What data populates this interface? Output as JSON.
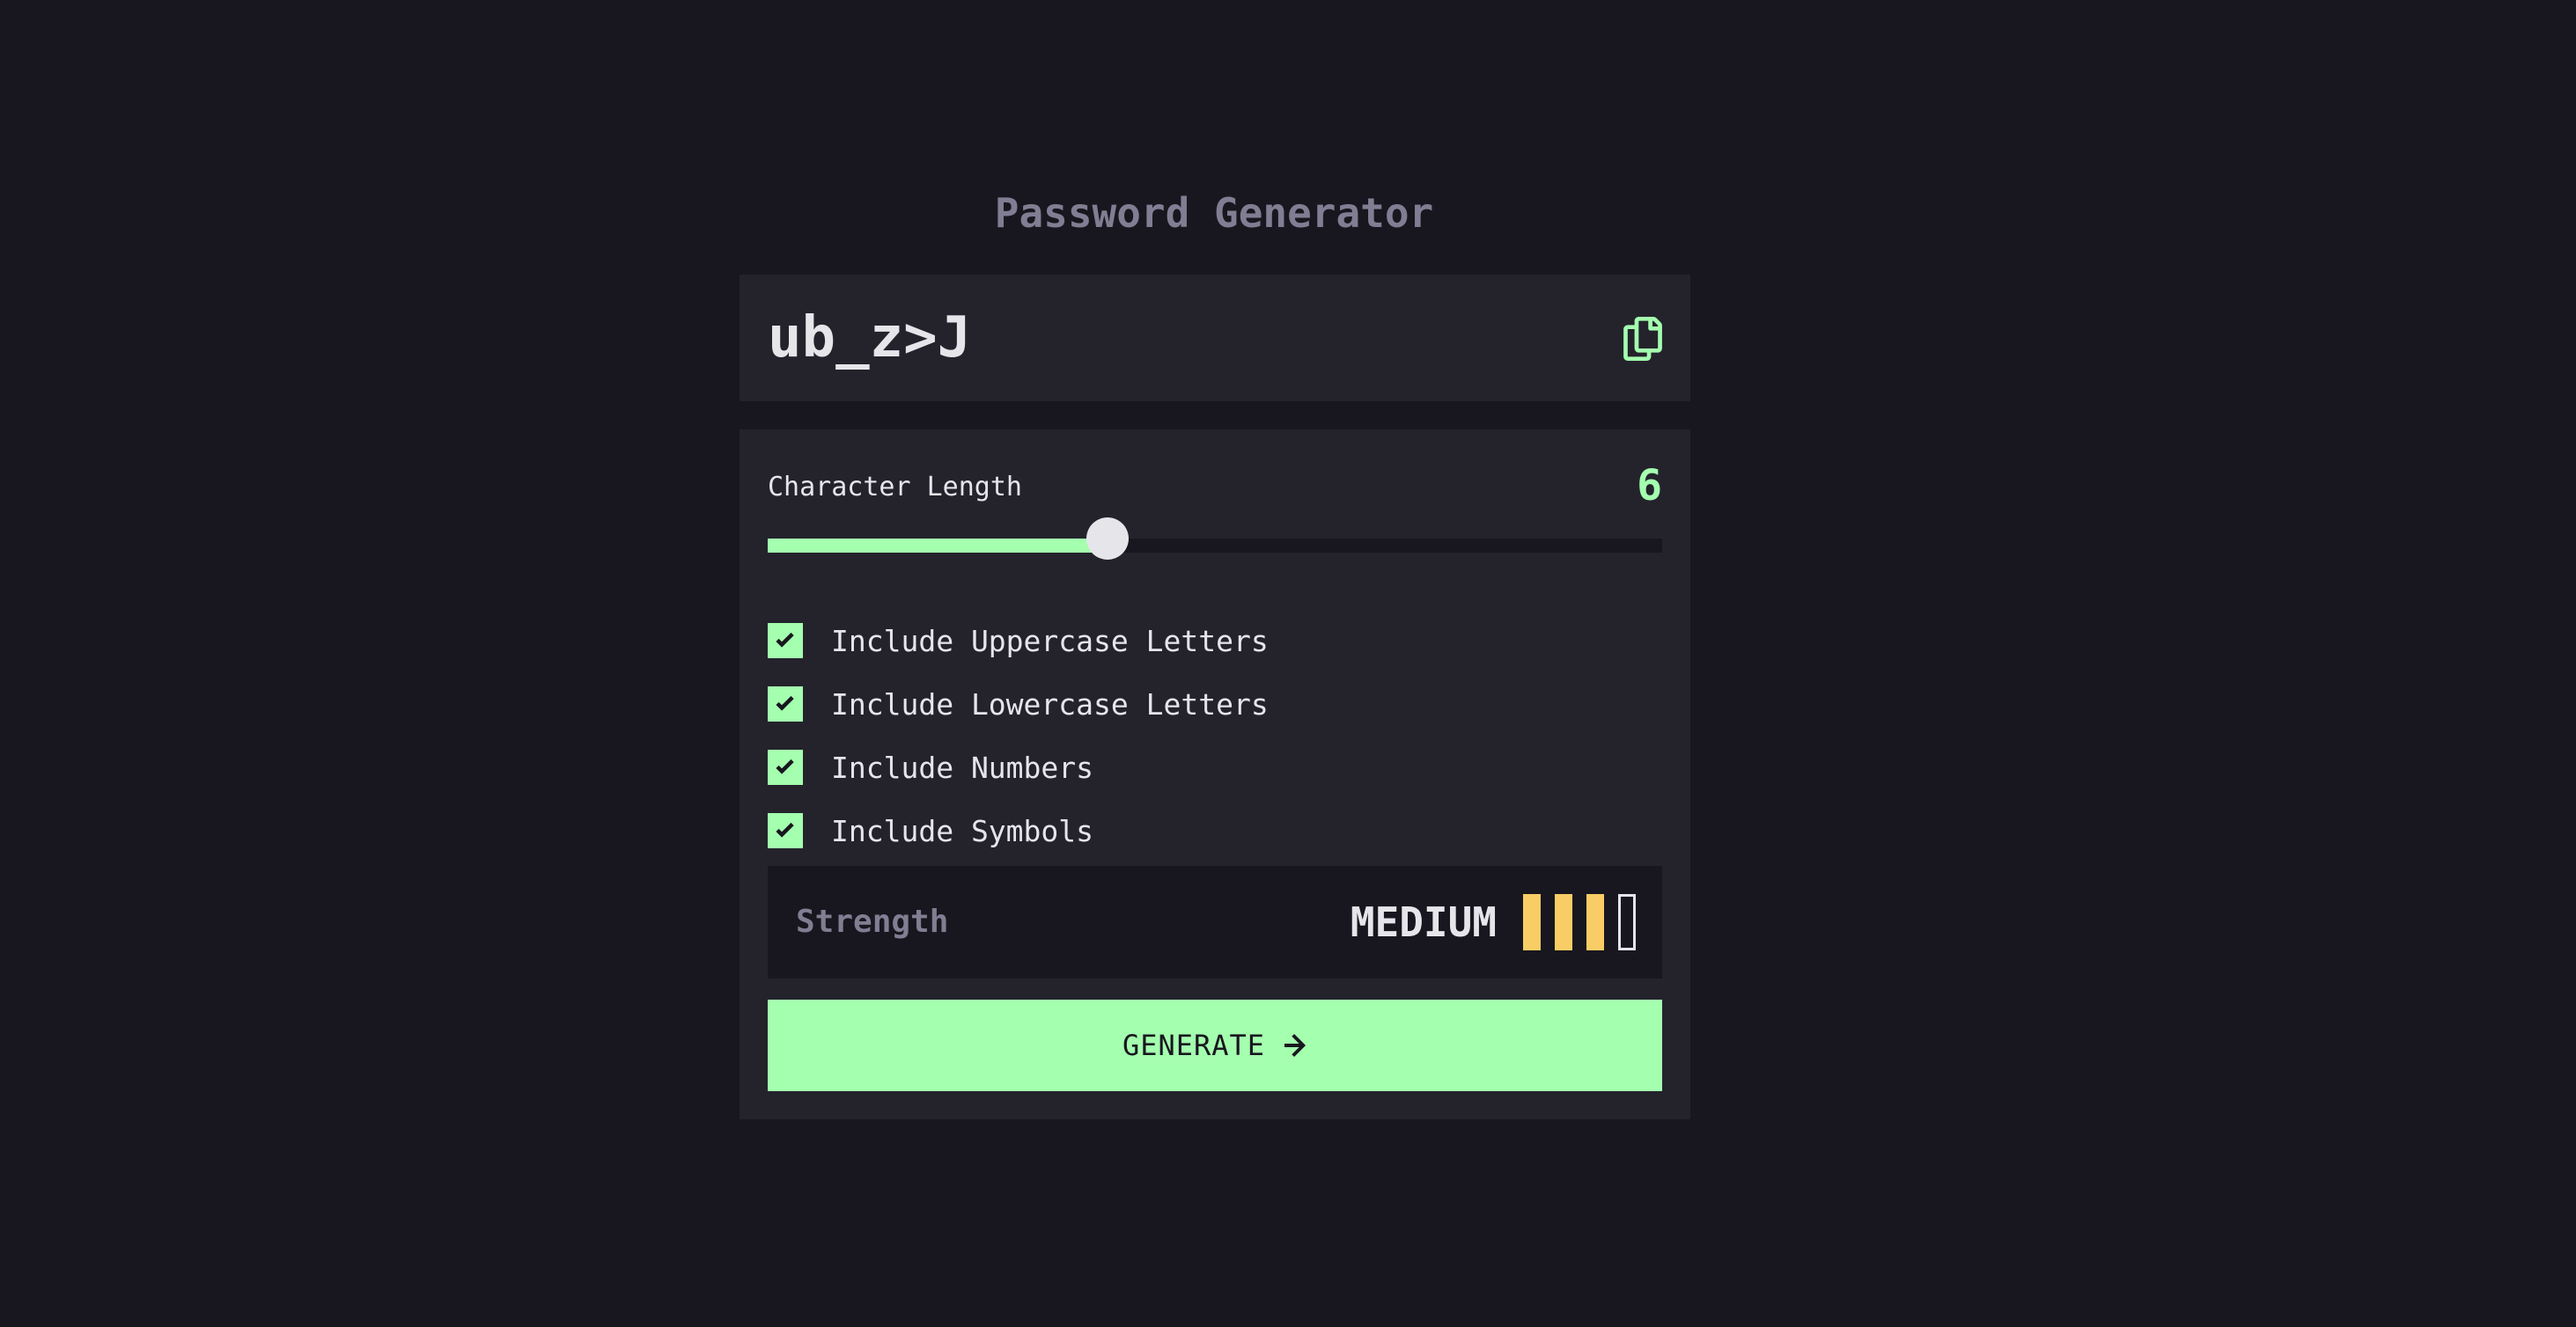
{
  "app": {
    "title": "Password Generator"
  },
  "output": {
    "password": "ub_z>J",
    "copy_icon": "copy-icon"
  },
  "length": {
    "label": "Character Length",
    "value": "6",
    "slider_fraction": 0.38
  },
  "options": [
    {
      "label": "Include Uppercase Letters",
      "checked": true
    },
    {
      "label": "Include Lowercase Letters",
      "checked": true
    },
    {
      "label": "Include Numbers",
      "checked": true
    },
    {
      "label": "Include Symbols",
      "checked": true
    }
  ],
  "strength": {
    "label": "Strength",
    "value": "MEDIUM",
    "bars_filled": 3,
    "bars_total": 4
  },
  "generate": {
    "label": "GENERATE",
    "icon": "arrow-right-icon"
  },
  "colors": {
    "accent": "#a4ffaf",
    "strength_medium": "#f8cd65",
    "background": "#18171f",
    "panel": "#24232c",
    "muted": "#817d92",
    "text": "#e6e5ea"
  }
}
